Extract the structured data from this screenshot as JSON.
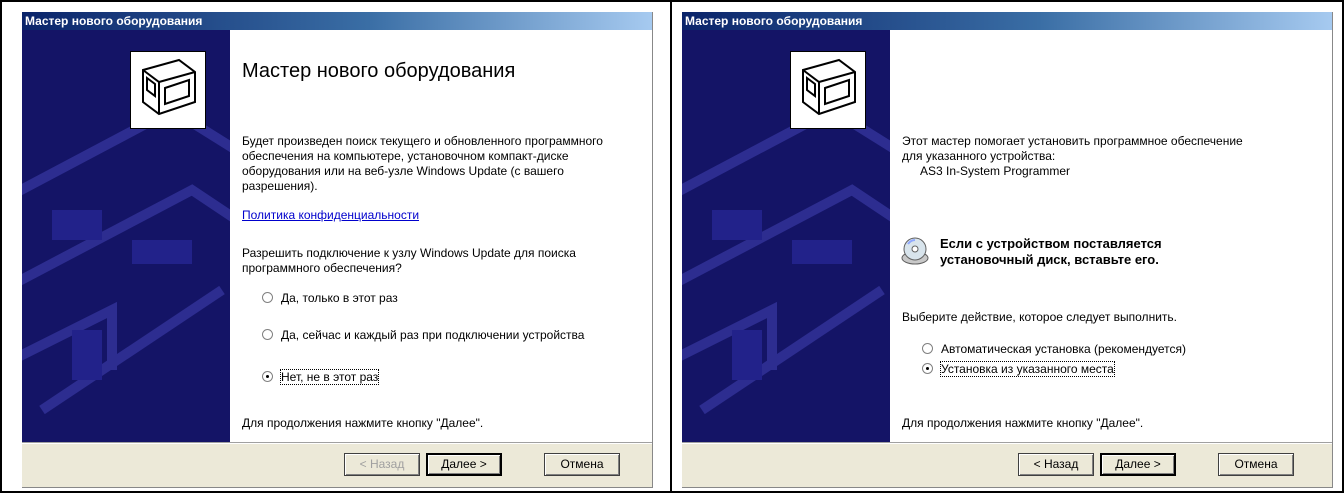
{
  "left_dialog": {
    "title": "Мастер нового оборудования",
    "heading": "Мастер нового оборудования",
    "intro": "Будет произведен поиск текущего и обновленного программного обеспечения на компьютере, установочном компакт-диске оборудования или на веб-узле Windows Update (с вашего разрешения).",
    "privacy_link": "Политика конфиденциальности",
    "question": "Разрешить подключение к узлу Windows Update для поиска программного обеспечения?",
    "options": [
      {
        "label": "Да, только в этот раз",
        "selected": false
      },
      {
        "label": "Да, сейчас и каждый раз при подключении устройства",
        "selected": false
      },
      {
        "label": "Нет, не в этот раз",
        "selected": true
      }
    ],
    "footer": "Для продолжения нажмите кнопку \"Далее\".",
    "buttons": {
      "back": "< Назад",
      "next": "Далее >",
      "cancel": "Отмена"
    },
    "back_enabled": false
  },
  "right_dialog": {
    "title": "Мастер нового оборудования",
    "intro": "Этот мастер помогает установить программное обеспечение для указанного устройства:",
    "device": "AS3 In-System Programmer",
    "disc_notice": "Если с устройством поставляется установочный диск, вставьте его.",
    "prompt": "Выберите действие, которое следует выполнить.",
    "options": [
      {
        "label": "Автоматическая установка (рекомендуется)",
        "selected": false
      },
      {
        "label": "Установка из указанного места",
        "selected": true
      }
    ],
    "footer": "Для продолжения нажмите кнопку \"Далее\".",
    "buttons": {
      "back": "< Назад",
      "next": "Далее >",
      "cancel": "Отмена"
    },
    "back_enabled": true
  },
  "icons": {
    "wizard": "hardware-board-icon",
    "disc": "cd-disc-icon"
  },
  "colors": {
    "titlebar_start": "#0a246a",
    "banner": "#1a1a6e",
    "dialog_bg": "#ece9d8",
    "link": "#0000cc"
  }
}
